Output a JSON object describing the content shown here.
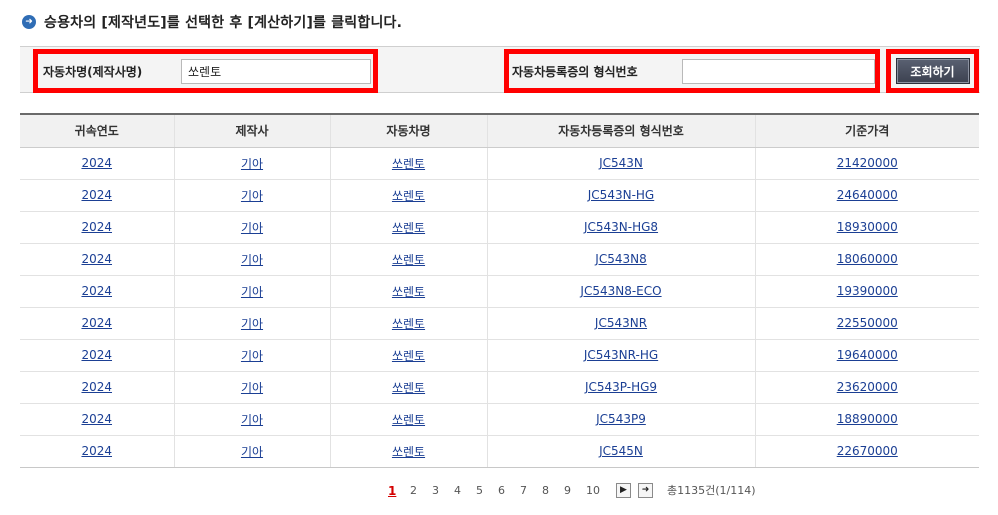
{
  "title": {
    "icon": "arrow-right-circle-icon",
    "text": "승용차의 [제작년도]를 선택한 후 [계산하기]를 클릭합니다."
  },
  "search": {
    "model_label": "자동차명(제작사명)",
    "model_value": "쏘렌토",
    "type_label": "자동차등록증의 형식번호",
    "type_value": "",
    "button_label": "조회하기",
    "highlight_color": "#ff0000"
  },
  "table": {
    "headers": [
      "귀속연도",
      "제작사",
      "자동차명",
      "자동차등록증의 형식번호",
      "기준가격"
    ],
    "rows": [
      [
        "2024",
        "기아",
        "쏘렌토",
        "JC543N",
        "21420000"
      ],
      [
        "2024",
        "기아",
        "쏘렌토",
        "JC543N-HG",
        "24640000"
      ],
      [
        "2024",
        "기아",
        "쏘렌토",
        "JC543N-HG8",
        "18930000"
      ],
      [
        "2024",
        "기아",
        "쏘렌토",
        "JC543N8",
        "18060000"
      ],
      [
        "2024",
        "기아",
        "쏘렌토",
        "JC543N8-ECO",
        "19390000"
      ],
      [
        "2024",
        "기아",
        "쏘렌토",
        "JC543NR",
        "22550000"
      ],
      [
        "2024",
        "기아",
        "쏘렌토",
        "JC543NR-HG",
        "19640000"
      ],
      [
        "2024",
        "기아",
        "쏘렌토",
        "JC543P-HG9",
        "23620000"
      ],
      [
        "2024",
        "기아",
        "쏘렌토",
        "JC543P9",
        "18890000"
      ],
      [
        "2024",
        "기아",
        "쏘렌토",
        "JC545N",
        "22670000"
      ]
    ]
  },
  "pagination": {
    "pages": [
      "1",
      "2",
      "3",
      "4",
      "5",
      "6",
      "7",
      "8",
      "9",
      "10"
    ],
    "current": "1",
    "next_icon": "arrow-next-icon",
    "last_icon": "arrow-last-icon",
    "summary": "총1135건(1/114)"
  }
}
